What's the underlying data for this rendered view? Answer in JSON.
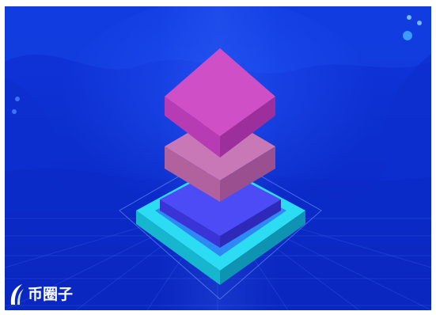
{
  "illustration": {
    "name": "stacked-layers-isometric",
    "colors": {
      "background_top": "#0d2fd6",
      "background_bottom": "#0a24b6",
      "wave": "#1b4fe6",
      "grid": "#3f6df0",
      "base_cyan": "#22d7f0",
      "base_blue": "#4a44f2",
      "middle_layer": "#c46ab1",
      "top_layer": "#cc4cc4"
    },
    "layers": [
      "base",
      "second",
      "middle",
      "top"
    ]
  },
  "watermark": {
    "text": "币圈子",
    "icon": "swoosh-logo-icon"
  }
}
